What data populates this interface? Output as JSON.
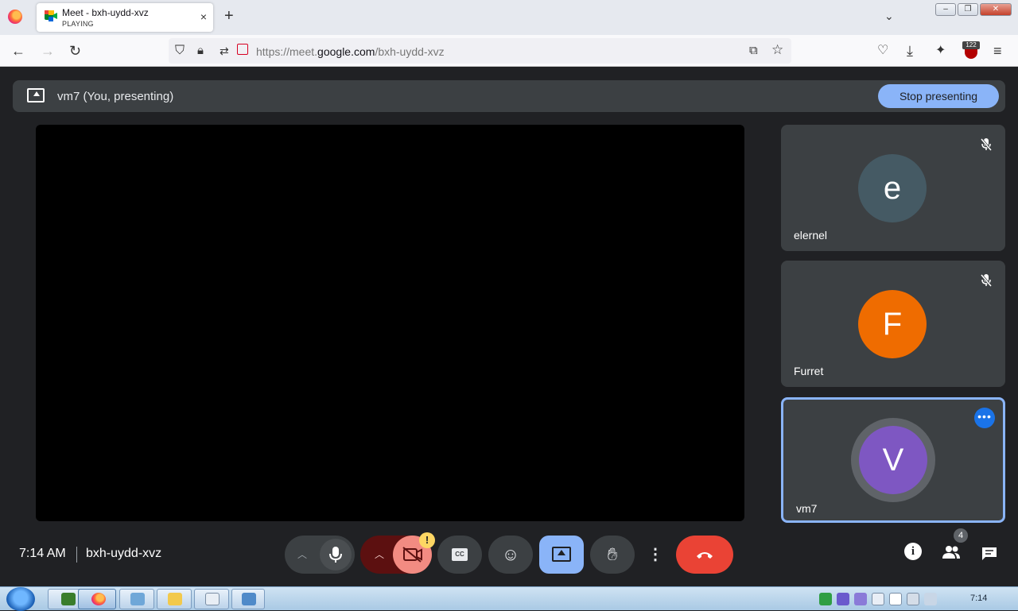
{
  "browser": {
    "tab": {
      "title": "Meet - bxh-uydd-xvz",
      "subtitle": "PLAYING",
      "close": "×"
    },
    "new_tab": "+",
    "tab_list": "⌄",
    "url_prefix": "https://meet.",
    "url_domain": "google.com",
    "url_path": "/bxh-uydd-xvz",
    "ext_badge": "122"
  },
  "meet": {
    "presenting_text": "vm7 (You, presenting)",
    "stop_presenting": "Stop presenting",
    "participants": [
      {
        "initial": "e",
        "name": "elernel",
        "color": "#455a64",
        "muted": true
      },
      {
        "initial": "F",
        "name": "Furret",
        "color": "#ef6c00",
        "muted": true
      },
      {
        "initial": "V",
        "name": "vm7",
        "color": "#7e57c2",
        "muted": false,
        "self": true
      }
    ],
    "more_options": "•••",
    "time": "7:14 AM",
    "meeting_code": "bxh-uydd-xvz",
    "camera_warning": "!",
    "participant_count": "4"
  },
  "taskbar": {
    "clock": "7:14"
  },
  "colors": {
    "accent": "#8ab4f8",
    "end_call": "#ea4335",
    "camera_off": "#f28b82",
    "camera_off_dark": "#5c1010"
  }
}
